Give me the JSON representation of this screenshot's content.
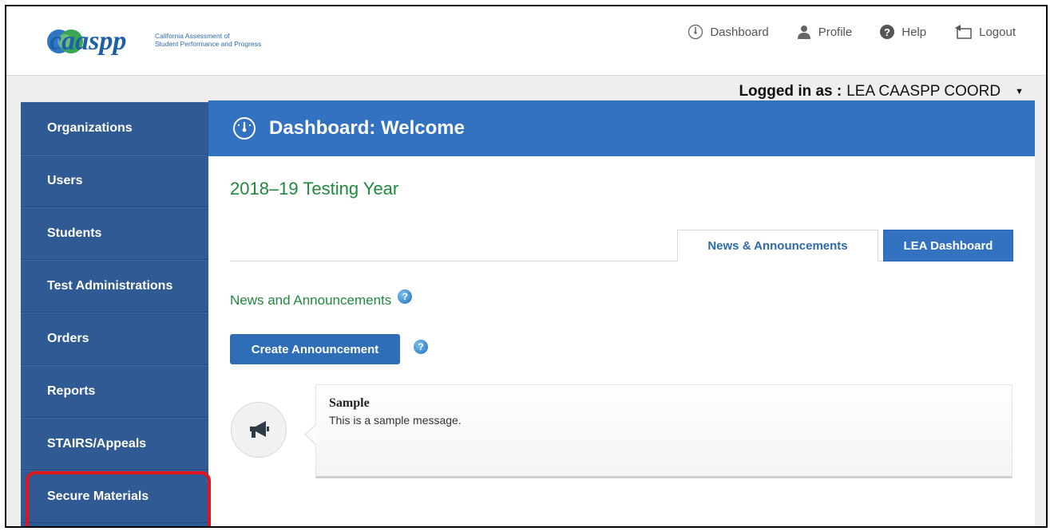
{
  "header": {
    "logo_word": "caaspp",
    "logo_line1": "California Assessment of",
    "logo_line2": "Student Performance and Progress",
    "nav": [
      {
        "label": "Dashboard",
        "icon": "dashboard-gauge-icon"
      },
      {
        "label": "Profile",
        "icon": "profile-person-icon"
      },
      {
        "label": "Help",
        "icon": "help-question-icon"
      },
      {
        "label": "Logout",
        "icon": "logout-door-icon"
      }
    ]
  },
  "session": {
    "logged_in_label": "Logged in as :",
    "user_role": "LEA CAASPP COORD"
  },
  "sidebar": {
    "items": [
      {
        "label": "Organizations"
      },
      {
        "label": "Users"
      },
      {
        "label": "Students"
      },
      {
        "label": "Test Administrations"
      },
      {
        "label": "Orders"
      },
      {
        "label": "Reports"
      },
      {
        "label": "STAIRS/Appeals"
      },
      {
        "label": "Secure Materials"
      }
    ],
    "highlight_color": "#e0141b"
  },
  "main": {
    "banner_title": "Dashboard: Welcome",
    "testing_year": "2018–19 Testing Year",
    "tabs": [
      {
        "label": "News & Announcements",
        "active": true
      },
      {
        "label": "LEA Dashboard",
        "active": false
      }
    ],
    "section_title": "News and Announcements",
    "create_button_label": "Create Announcement",
    "announcement": {
      "title": "Sample",
      "body": "This is a sample message.",
      "icon": "megaphone-icon"
    }
  },
  "colors": {
    "sidebar_bg": "#2f5a93",
    "banner_bg": "#3272c0",
    "accent_green": "#1f8a3c"
  }
}
